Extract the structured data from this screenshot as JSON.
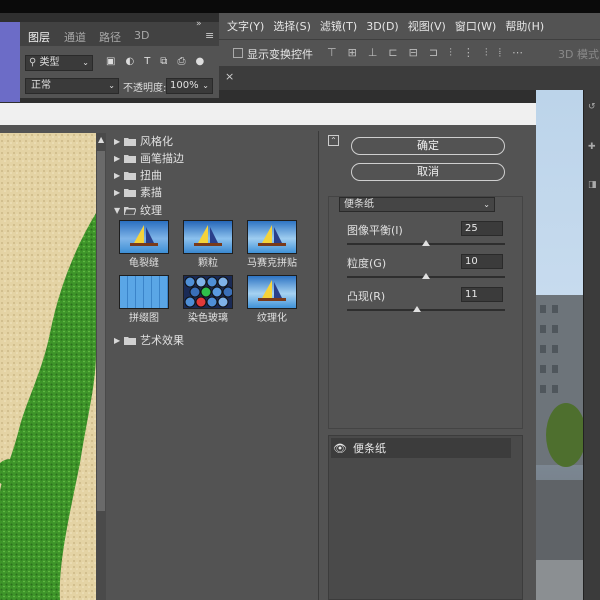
{
  "layers_panel": {
    "tabs": [
      "图层",
      "通道",
      "路径",
      "3D"
    ],
    "filter_type": "类型",
    "blend_mode": "正常",
    "opacity_label": "不透明度:",
    "opacity_value": "100%"
  },
  "menubar": {
    "items": [
      "文字(Y)",
      "选择(S)",
      "滤镜(T)",
      "3D(D)",
      "视图(V)",
      "窗口(W)",
      "帮助(H)"
    ]
  },
  "options_bar": {
    "show_transform": "显示变换控件",
    "mode_3d": "3D 模式:"
  },
  "filter_gallery": {
    "categories": [
      {
        "label": "风格化",
        "expanded": false
      },
      {
        "label": "画笔描边",
        "expanded": false
      },
      {
        "label": "扭曲",
        "expanded": false
      },
      {
        "label": "素描",
        "expanded": false
      },
      {
        "label": "纹理",
        "expanded": true
      },
      {
        "label": "艺术效果",
        "expanded": false
      }
    ],
    "texture_filters": [
      "龟裂缝",
      "颗粒",
      "马赛克拼贴",
      "拼缀图",
      "染色玻璃",
      "纹理化"
    ],
    "ok_label": "确定",
    "cancel_label": "取消",
    "selected_filter": "便条纸",
    "params": [
      {
        "label": "图像平衡(I)",
        "value": "25",
        "fraction": 0.5
      },
      {
        "label": "粒度(G)",
        "value": "10",
        "fraction": 0.5
      },
      {
        "label": "凸现(R)",
        "value": "11",
        "fraction": 0.44
      }
    ],
    "applied_layer": "便条纸"
  },
  "colors": {
    "ps_panel": "#535353",
    "ps_dark": "#3b3b3b",
    "preview_sand": "#e6d6a8",
    "preview_green": "#3f9a2b"
  }
}
